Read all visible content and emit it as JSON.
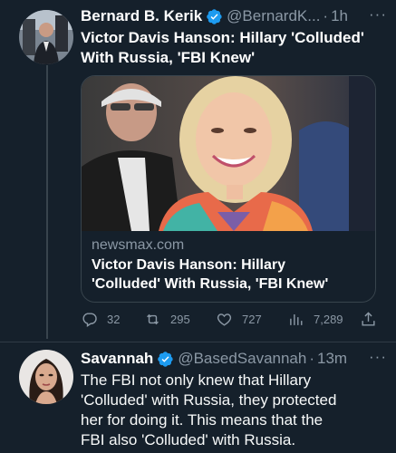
{
  "tweets": [
    {
      "display_name": "Bernard B. Kerik",
      "handle": "@BernardK...",
      "time": "1h",
      "more": "···",
      "text": "Victor Davis Hanson: Hillary 'Colluded'\nWith Russia, 'FBI Knew'",
      "card": {
        "domain": "newsmax.com",
        "title": "Victor Davis Hanson: Hillary\n'Colluded' With Russia, 'FBI Knew'"
      },
      "actions": {
        "replies": "32",
        "retweets": "295",
        "likes": "727",
        "views": "7,289"
      }
    },
    {
      "display_name": "Savannah",
      "handle": "@BasedSavannah",
      "time": "13m",
      "more": "···",
      "text": "The FBI not only knew that Hillary\n'Colluded' with Russia, they protected\nher for doing it.  This means that the\nFBI also 'Colluded' with Russia."
    }
  ],
  "separator": "·",
  "icons": {
    "verified": "verified-badge-icon",
    "reply": "reply-icon",
    "retweet": "retweet-icon",
    "like": "heart-icon",
    "views": "views-chart-icon",
    "share": "share-icon"
  },
  "colors": {
    "background": "#15202b",
    "verified": "#1d9bf0",
    "secondary_text": "#8b98a5",
    "border": "#38444d"
  }
}
